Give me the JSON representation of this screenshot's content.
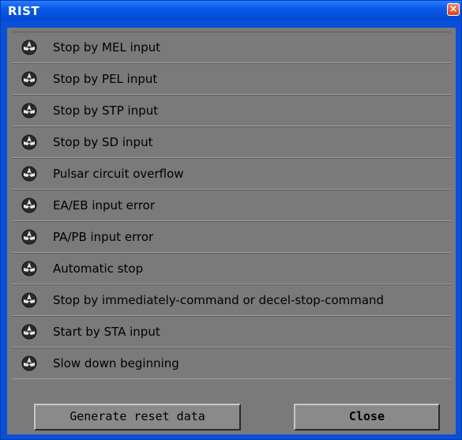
{
  "window": {
    "title": "RIST",
    "close_glyph": "×"
  },
  "items": [
    {
      "label": "Stop by MEL input",
      "icon": "led-icon"
    },
    {
      "label": "Stop by PEL input",
      "icon": "led-icon"
    },
    {
      "label": "Stop by STP input",
      "icon": "led-icon"
    },
    {
      "label": "Stop by SD input",
      "icon": "led-icon"
    },
    {
      "label": "Pulsar circuit overflow",
      "icon": "led-icon"
    },
    {
      "label": "EA/EB input error",
      "icon": "led-icon"
    },
    {
      "label": "PA/PB input error",
      "icon": "led-icon"
    },
    {
      "label": "Automatic stop",
      "icon": "led-icon"
    },
    {
      "label": "Stop by immediately-command or decel-stop-command",
      "icon": "led-icon"
    },
    {
      "label": "Start by STA input",
      "icon": "led-icon"
    },
    {
      "label": "Slow down beginning",
      "icon": "led-icon"
    }
  ],
  "buttons": {
    "generate": "Generate reset data",
    "close": "Close"
  },
  "colors": {
    "titlebar": "#0a5ae8",
    "panel": "#7a7a7a",
    "close_button": "#d0401e"
  }
}
